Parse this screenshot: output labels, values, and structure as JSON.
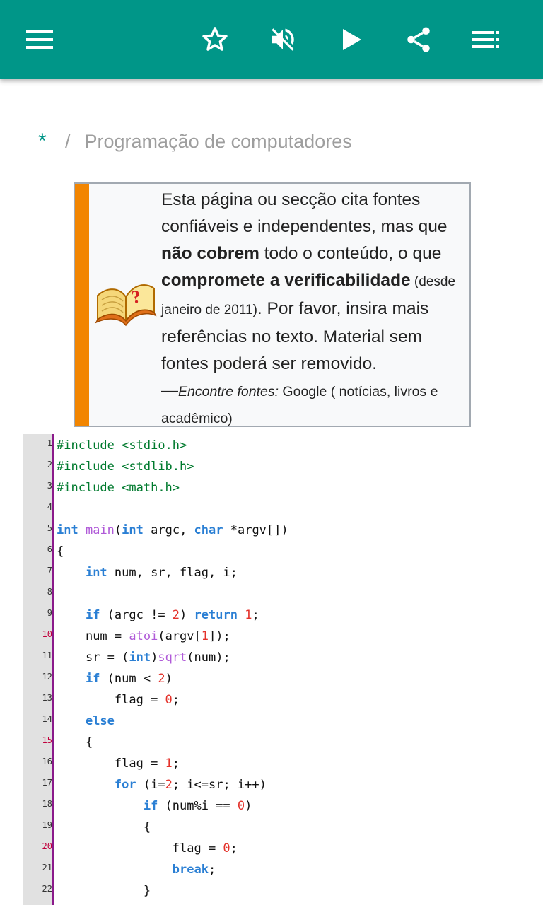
{
  "toolbar": {
    "menu_icon": "hamburger-menu-icon",
    "favorite_icon": "star-outline-icon",
    "mute_icon": "volume-off-icon",
    "play_icon": "play-icon",
    "share_icon": "share-icon",
    "contents_icon": "list-icon",
    "color": "#009688"
  },
  "breadcrumb": {
    "root": "*",
    "separator": "/",
    "current": "Programação de computadores"
  },
  "notice": {
    "accent_color": "#f28500",
    "icon": "book-question-icon",
    "p1": "Esta página ou secção cita fontes confiáveis e independentes, mas que ",
    "b1": "não cobrem",
    "p2": " todo o conteúdo, o que ",
    "b2": "compromete a verificabilidade",
    "s1": " (desde janeiro de 2011)",
    "p3": ". Por favor, insira mais referências no texto. Material sem fontes poderá ser removido.",
    "dash": "—",
    "find_label": "Encontre fontes:",
    "find_links": " Google ( notícias, livros e acadêmico)"
  },
  "code": {
    "line_numbers": [
      "1",
      "2",
      "3",
      "4",
      "5",
      "6",
      "7",
      "8",
      "9",
      "10",
      "11",
      "12",
      "13",
      "14",
      "15",
      "16",
      "17",
      "18",
      "19",
      "20",
      "21",
      "22"
    ],
    "t": {
      "inc": "#include",
      "stdio": "<stdio.h>",
      "stdlib": "<stdlib.h>",
      "math": "<math.h>",
      "int": "int",
      "main": "main",
      "paren_open": "(",
      "argc_decl": " argc, ",
      "char": "char",
      "argv_decl": " *argv[])",
      "brace_open": "{",
      "brace_close": "}",
      "decl": " num, sr, flag, i;",
      "if": "if",
      "argc_cmp": " (argc != ",
      "two": "2",
      "close_sp": ") ",
      "return": "return",
      "one": "1",
      "semi": ";",
      "num_assign": "num = ",
      "atoi": "atoi",
      "argv_open": "(argv[",
      "argv_close": "]);",
      "sr_assign": "sr = (",
      "int_close": ")",
      "sqrt": "sqrt",
      "num_arg": "(num);",
      "num_lt": " (num < ",
      "paren_close": ")",
      "flag_assign": "flag = ",
      "zero": "0",
      "else": "else",
      "for": "for",
      "for_init": " (i=",
      "for_rest": "; i<=sr; i++)",
      "mod_cmp": " (num%i == ",
      "break": "break"
    }
  }
}
